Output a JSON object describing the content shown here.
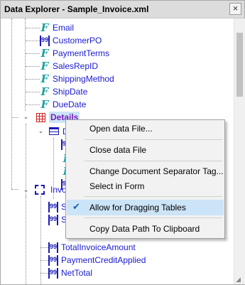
{
  "window": {
    "title": "Data Explorer - Sample_Invoice.xml",
    "close_glyph": "×"
  },
  "tree": {
    "header_fields": [
      "Email",
      "CustomerPO",
      "PaymentTerms",
      "SalesRepID",
      "ShippingMethod",
      "ShipDate",
      "DueDate"
    ],
    "details_label": "Details",
    "detail_child_label": "D",
    "invoice_group_label": "Invo",
    "totals_partial": [
      "S",
      "S"
    ],
    "totals_fields": [
      "TotalInvoiceAmount",
      "PaymentCreditApplied",
      "NetTotal"
    ],
    "field_icon_glyph": "F",
    "numeric_icon_text": "99"
  },
  "context_menu": {
    "items": [
      {
        "label": "Open data File..."
      },
      {
        "label": "Close data File"
      },
      {
        "label": "Change Document Separator Tag..."
      },
      {
        "label": "Select in Form"
      },
      {
        "label": "Allow for Dragging Tables",
        "checked": true
      },
      {
        "label": "Copy Data Path To Clipboard"
      }
    ],
    "check_glyph": "✔"
  }
}
